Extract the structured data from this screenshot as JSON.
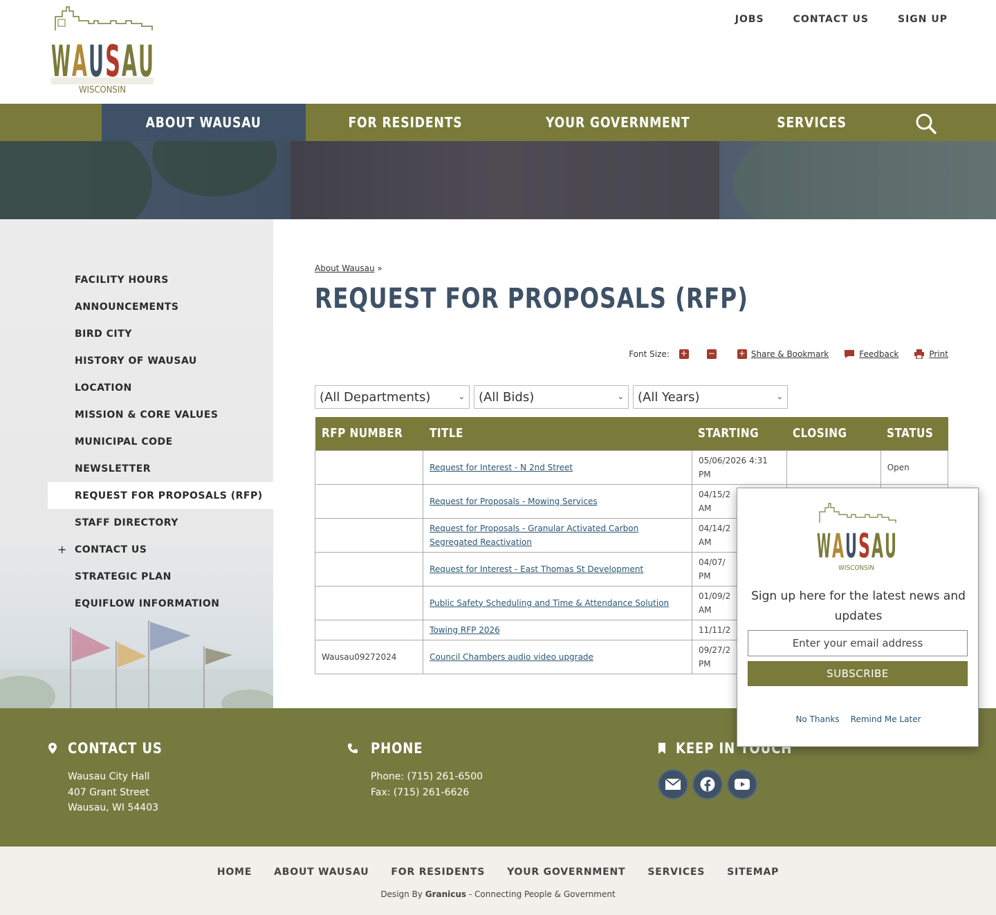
{
  "logo": {
    "main": "WAUSAU",
    "sub": "WISCONSIN"
  },
  "topnav": [
    "JOBS",
    "CONTACT US",
    "SIGN UP"
  ],
  "mainnav": [
    "ABOUT WAUSAU",
    "FOR RESIDENTS",
    "YOUR GOVERNMENT",
    "SERVICES"
  ],
  "sidebar": {
    "items": [
      {
        "label": "FACILITY HOURS"
      },
      {
        "label": "ANNOUNCEMENTS"
      },
      {
        "label": "BIRD CITY"
      },
      {
        "label": "HISTORY OF WAUSAU"
      },
      {
        "label": "LOCATION"
      },
      {
        "label": "MISSION & CORE VALUES"
      },
      {
        "label": "MUNICIPAL CODE"
      },
      {
        "label": "NEWSLETTER"
      },
      {
        "label": "REQUEST FOR PROPOSALS (RFP)"
      },
      {
        "label": "STAFF DIRECTORY"
      },
      {
        "label": "CONTACT US"
      },
      {
        "label": "STRATEGIC PLAN"
      },
      {
        "label": "EQUIFLOW INFORMATION"
      }
    ]
  },
  "breadcrumb": {
    "link": "About Wausau",
    "sep": "»"
  },
  "page_title": "REQUEST FOR PROPOSALS (RFP)",
  "tools": {
    "font_size": "Font Size:",
    "plus": "+",
    "minus": "−",
    "share": "Share & Bookmark",
    "feedback": "Feedback",
    "print": "Print"
  },
  "filters": [
    "(All Departments)",
    "(All Bids)",
    "(All Years)"
  ],
  "table": {
    "headers": [
      "RFP NUMBER",
      "TITLE",
      "STARTING",
      "CLOSING",
      "STATUS"
    ],
    "rows": [
      {
        "num": "",
        "title": "Request for Interest - N 2nd Street",
        "start": "05/06/2026 4:31 PM",
        "close": "",
        "status": "Open"
      },
      {
        "num": "",
        "title": "Request for Proposals - Mowing Services",
        "start": "04/15/2",
        "start2": "AM",
        "close": "",
        "status": ""
      },
      {
        "num": "",
        "title": "Request for Proposals - Granular Activated Carbon Segregated Reactivation",
        "start": "04/14/2",
        "start2": "AM",
        "close": "",
        "status": ""
      },
      {
        "num": "",
        "title": "Request for Interest - East Thomas St Development",
        "start": "04/07/",
        "start2": "PM",
        "close": "",
        "status": ""
      },
      {
        "num": "",
        "title": "Public Safety Scheduling and Time & Attendance Solution",
        "start": "01/09/2",
        "start2": "AM",
        "close": "",
        "status": ""
      },
      {
        "num": "",
        "title": "Towing RFP 2026",
        "start": "11/11/2",
        "start2": "",
        "close": "",
        "status": ""
      },
      {
        "num": "Wausau09272024",
        "title": "Council Chambers audio video upgrade",
        "start": "09/27/2",
        "start2": "PM",
        "close": "",
        "status": ""
      }
    ]
  },
  "footer": {
    "contact": {
      "title": "CONTACT US",
      "lines": [
        "Wausau City Hall",
        "407 Grant Street",
        "Wausau, WI 54403"
      ]
    },
    "phone": {
      "title": "PHONE",
      "lines": [
        "Phone: (715) 261-6500",
        "Fax: (715) 261-6626"
      ]
    },
    "keep": {
      "title": "KEEP IN TOUCH"
    }
  },
  "bottomnav": [
    "HOME",
    "ABOUT WAUSAU",
    "FOR RESIDENTS",
    "YOUR GOVERNMENT",
    "SERVICES",
    "SITEMAP"
  ],
  "credit": {
    "prefix": "Design By ",
    "brand": "Granicus",
    "suffix": " - Connecting People & Government"
  },
  "modal": {
    "text": "Sign up here for the latest news and updates",
    "email_placeholder": "Enter your email address",
    "subscribe": "SUBSCRIBE",
    "no_thanks": "No Thanks",
    "remind": "Remind Me Later"
  },
  "colors": {
    "olive": "#7a7b3a",
    "navy": "#3e5166",
    "red": "#a33a2a",
    "link": "#2a5674"
  }
}
